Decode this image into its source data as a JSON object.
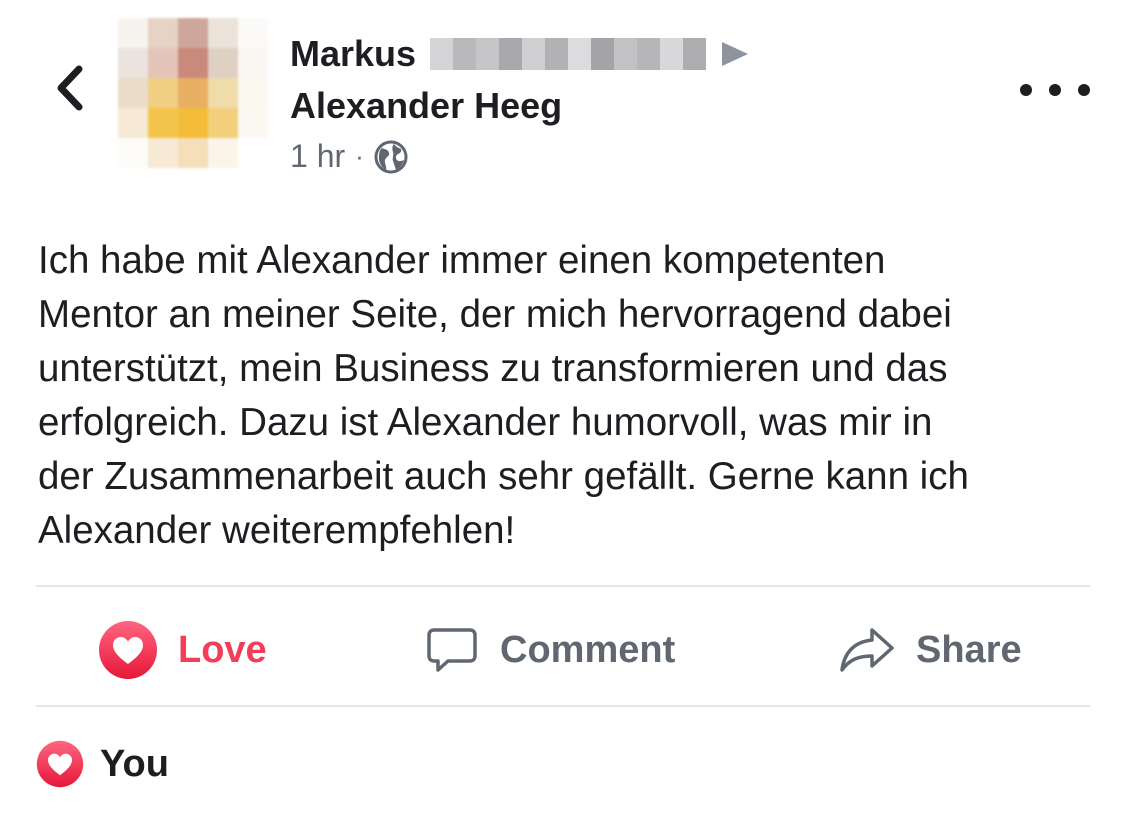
{
  "header": {
    "author_first": "Markus",
    "target_name": "Alexander Heeg",
    "timestamp": "1 hr",
    "separator": "·",
    "privacy_icon": "globe-icon",
    "back_icon": "chevron-left-icon",
    "more_icon": "more-horizontal-icon"
  },
  "post": {
    "lines": [
      "Ich habe mit Alexander immer einen kompetenten",
      "Mentor an meiner Seite, der mich hervorragend dabei",
      "unterstützt, mein Business zu transformieren und das",
      "erfolgreich. Dazu ist Alexander humorvoll, was mir in",
      "der Zusammenarbeit auch sehr gefällt. Gerne kann ich",
      "Alexander weiterempfehlen!"
    ]
  },
  "actions": {
    "love_label": "Love",
    "comment_label": "Comment",
    "share_label": "Share"
  },
  "reactions": {
    "label": "You",
    "icon": "love-reaction-icon"
  },
  "colors": {
    "love": "#f33e58",
    "secondary_text": "#606770",
    "divider": "#e4e6eb",
    "primary_text": "#1c1e21"
  }
}
